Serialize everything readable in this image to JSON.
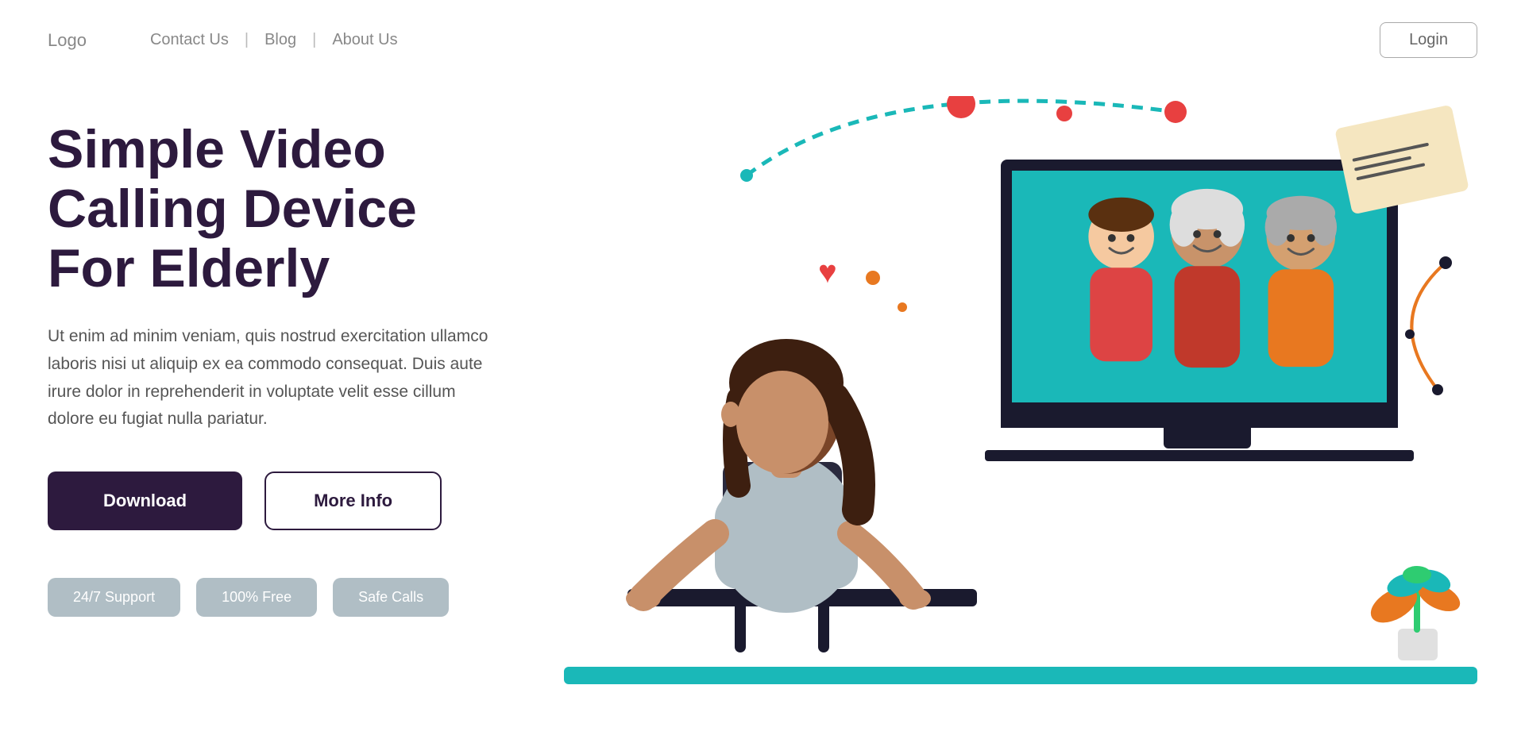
{
  "navbar": {
    "logo": "Logo",
    "links": [
      {
        "label": "Contact Us",
        "id": "contact-us"
      },
      {
        "label": "Blog",
        "id": "blog"
      },
      {
        "label": "About Us",
        "id": "about-us"
      }
    ],
    "login_label": "Login"
  },
  "hero": {
    "title": "Simple Video Calling Device For Elderly",
    "description": "Ut enim ad minim veniam, quis nostrud exercitation ullamco laboris nisi ut aliquip ex ea commodo consequat. Duis aute irure dolor in reprehenderit in voluptate velit esse cillum dolore eu fugiat nulla pariatur.",
    "download_label": "Download",
    "more_info_label": "More Info",
    "badges": [
      {
        "label": "24/7 Support"
      },
      {
        "label": "100% Free"
      },
      {
        "label": "Safe Calls"
      }
    ]
  },
  "colors": {
    "primary_dark": "#2d1a3e",
    "teal": "#1ab8b8",
    "red": "#e84040",
    "orange": "#e87820",
    "badge_bg": "#b0bec5"
  }
}
